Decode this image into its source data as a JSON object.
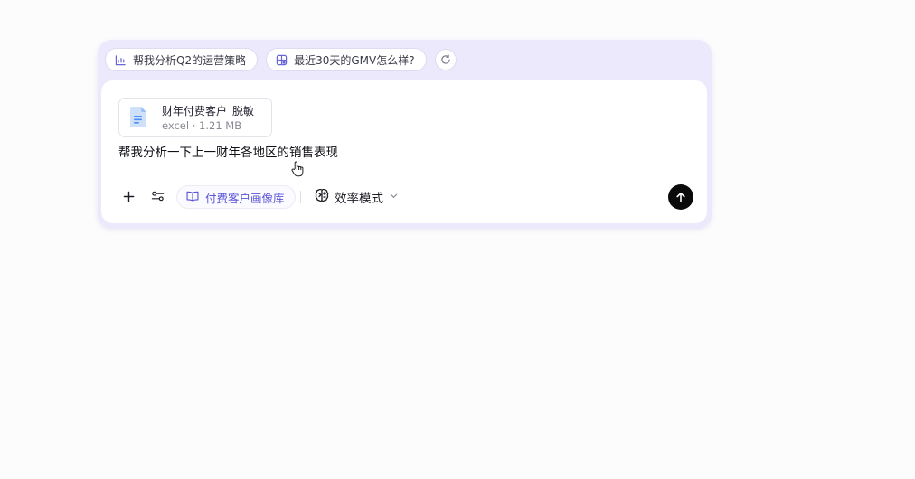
{
  "suggestions": [
    {
      "label": "帮我分析Q2的运营策略",
      "icon": "bar-chart-icon"
    },
    {
      "label": "最近30天的GMV怎么样?",
      "icon": "layout-grid-icon"
    }
  ],
  "refresh_icon": "refresh-icon",
  "attachment": {
    "name": "财年付费客户_脱敏",
    "type": "excel",
    "separator": "·",
    "size": "1.21 MB",
    "icon": "document-icon"
  },
  "prompt_text": "帮我分析一下上一财年各地区的销售表现",
  "toolbar": {
    "add_icon": "plus-icon",
    "settings_icon": "sliders-icon",
    "knowledge_base_label": "付费客户画像库",
    "knowledge_base_icon": "book-icon",
    "mode_label": "效率模式",
    "mode_icon": "brain-icon",
    "mode_dropdown_icon": "chevron-down-icon",
    "send_icon": "arrow-up-icon"
  },
  "colors": {
    "accent": "#5a55d6",
    "card_background": "#ebe9fb",
    "send_button": "#0a0a0a",
    "document_blue": "#4d8ef0"
  }
}
